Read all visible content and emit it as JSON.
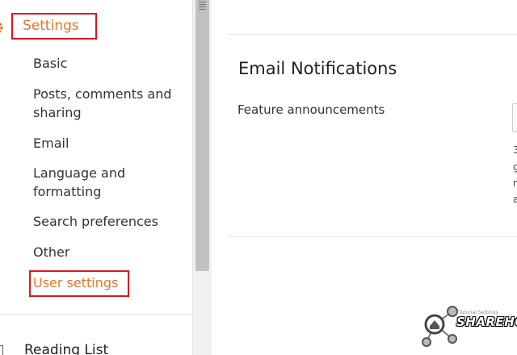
{
  "sidebar": {
    "settings_label": "Settings",
    "items": [
      {
        "label": "Basic"
      },
      {
        "label": "Posts, comments and",
        "label2": "sharing"
      },
      {
        "label": "Email"
      },
      {
        "label": "Language and",
        "label2": "formatting"
      },
      {
        "label": "Search preferences"
      },
      {
        "label": "Other"
      },
      {
        "label": "User settings"
      }
    ],
    "reading_list_label": "Reading List"
  },
  "main": {
    "section_title": "Email Notifications",
    "feature_label": "Feature announcements",
    "cut_text": [
      "3",
      "g",
      "r",
      "a"
    ]
  },
  "watermark": {
    "brand": "SHAREHOVEL",
    "tag": "Tutorial Settings"
  },
  "colors": {
    "accent": "#e8742a",
    "highlight_box": "#e0141e",
    "text": "#333333"
  }
}
